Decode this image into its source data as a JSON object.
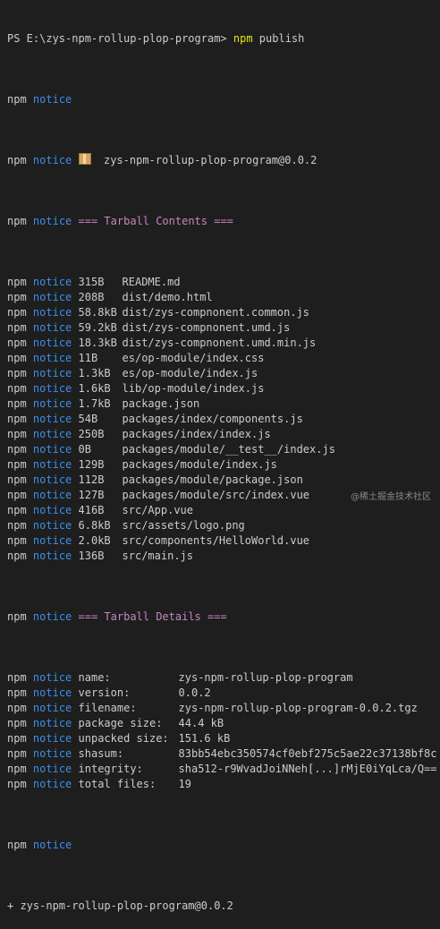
{
  "command": {
    "prompt": "PS E:\\zys-npm-rollup-plop-program>",
    "executable": "npm",
    "args": "publish"
  },
  "log_prefix": "npm",
  "log_level": "notice",
  "package_icon": "package-icon",
  "package_line": "zys-npm-rollup-plop-program@0.0.2",
  "tarball_contents_heading": "=== Tarball Contents ===",
  "files": [
    {
      "size": "315B",
      "path": "README.md"
    },
    {
      "size": "208B",
      "path": "dist/demo.html"
    },
    {
      "size": "58.8kB",
      "path": "dist/zys-compnonent.common.js"
    },
    {
      "size": "59.2kB",
      "path": "dist/zys-compnonent.umd.js"
    },
    {
      "size": "18.3kB",
      "path": "dist/zys-compnonent.umd.min.js"
    },
    {
      "size": "11B",
      "path": "es/op-module/index.css"
    },
    {
      "size": "1.3kB",
      "path": "es/op-module/index.js"
    },
    {
      "size": "1.6kB",
      "path": "lib/op-module/index.js"
    },
    {
      "size": "1.7kB",
      "path": "package.json"
    },
    {
      "size": "54B",
      "path": "packages/index/components.js"
    },
    {
      "size": "250B",
      "path": "packages/index/index.js"
    },
    {
      "size": "0B",
      "path": "packages/module/__test__/index.js"
    },
    {
      "size": "129B",
      "path": "packages/module/index.js"
    },
    {
      "size": "112B",
      "path": "packages/module/package.json"
    },
    {
      "size": "127B",
      "path": "packages/module/src/index.vue"
    },
    {
      "size": "416B",
      "path": "src/App.vue"
    },
    {
      "size": "6.8kB",
      "path": "src/assets/logo.png"
    },
    {
      "size": "2.0kB",
      "path": "src/components/HelloWorld.vue"
    },
    {
      "size": "136B",
      "path": "src/main.js"
    }
  ],
  "tarball_details_heading": "=== Tarball Details ===",
  "details": [
    {
      "key": "name:",
      "value": "zys-npm-rollup-plop-program"
    },
    {
      "key": "version:",
      "value": "0.0.2"
    },
    {
      "key": "filename:",
      "value": "zys-npm-rollup-plop-program-0.0.2.tgz"
    },
    {
      "key": "package size:",
      "value": "44.4 kB"
    },
    {
      "key": "unpacked size:",
      "value": "151.6 kB"
    },
    {
      "key": "shasum:",
      "value": "83bb54ebc350574cf0ebf275c5ae22c37138bf8c"
    },
    {
      "key": "integrity:",
      "value": "sha512-r9WvadJoiNNeh[...]rMjE0iYqLca/Q=="
    },
    {
      "key": "total files:",
      "value": "19"
    }
  ],
  "result_line": "+ zys-npm-rollup-plop-program@0.0.2",
  "watermark": "@稀土掘金技术社区"
}
